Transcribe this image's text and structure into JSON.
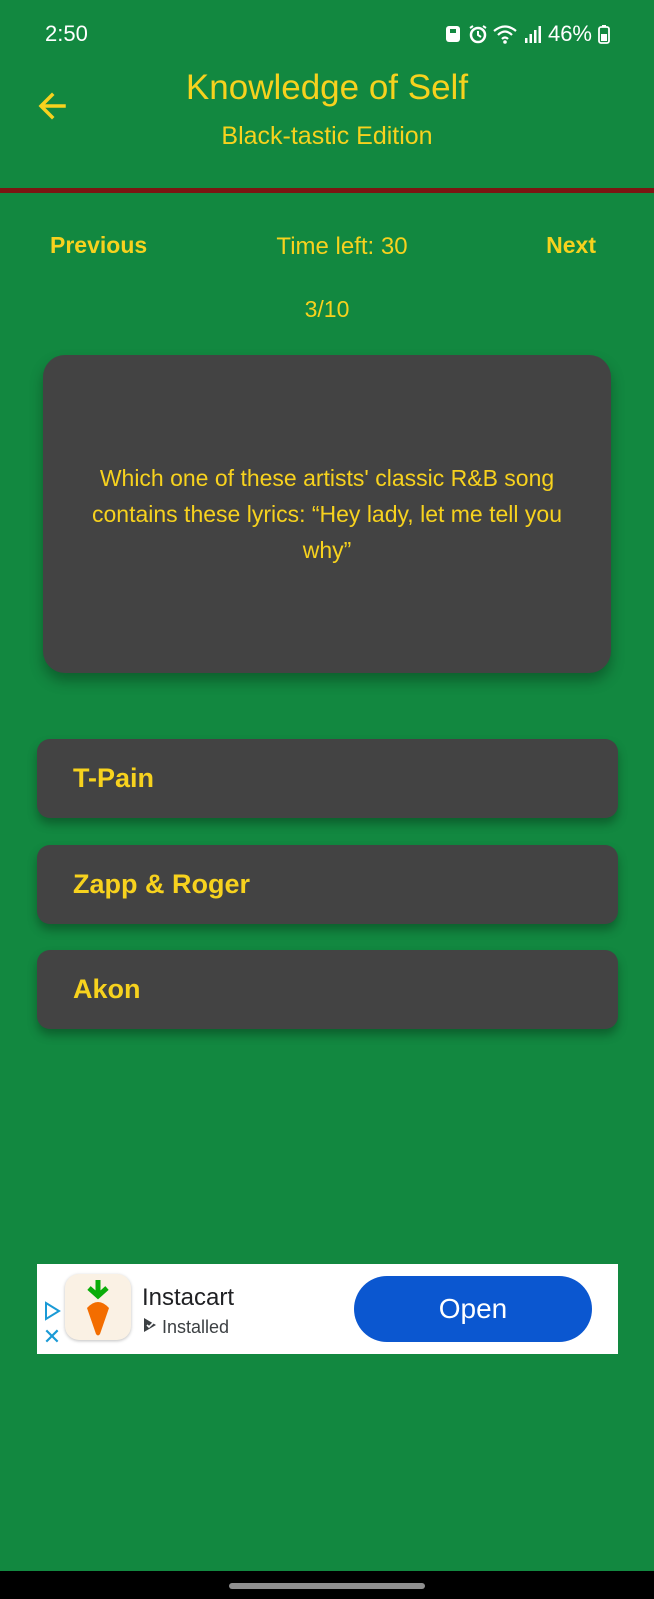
{
  "status_bar": {
    "time": "2:50",
    "battery": "46%",
    "icons": [
      "save-icon",
      "alarm-icon",
      "wifi-icon",
      "signal-icon",
      "battery-icon"
    ]
  },
  "app_bar": {
    "back_icon": "arrow-back-icon",
    "title": "Knowledge of Self",
    "subtitle": "Black-tastic Edition"
  },
  "controls": {
    "previous_label": "Previous",
    "timer_text": "Time left: 30",
    "next_label": "Next",
    "counter": "3/10"
  },
  "question": {
    "text": "Which one of these artists' classic R&B song contains these lyrics: “Hey lady, let me tell you why”"
  },
  "answers": [
    {
      "label": "T-Pain"
    },
    {
      "label": "Zapp & Roger"
    },
    {
      "label": "Akon"
    }
  ],
  "ad": {
    "app_name": "Instacart",
    "status": "Installed",
    "button_label": "Open",
    "close_glyph": "✕"
  },
  "colors": {
    "background": "#128840",
    "accent_text": "#f7d21e",
    "card": "#434343",
    "divider": "#7b1612",
    "ad_button": "#0b57d0"
  }
}
